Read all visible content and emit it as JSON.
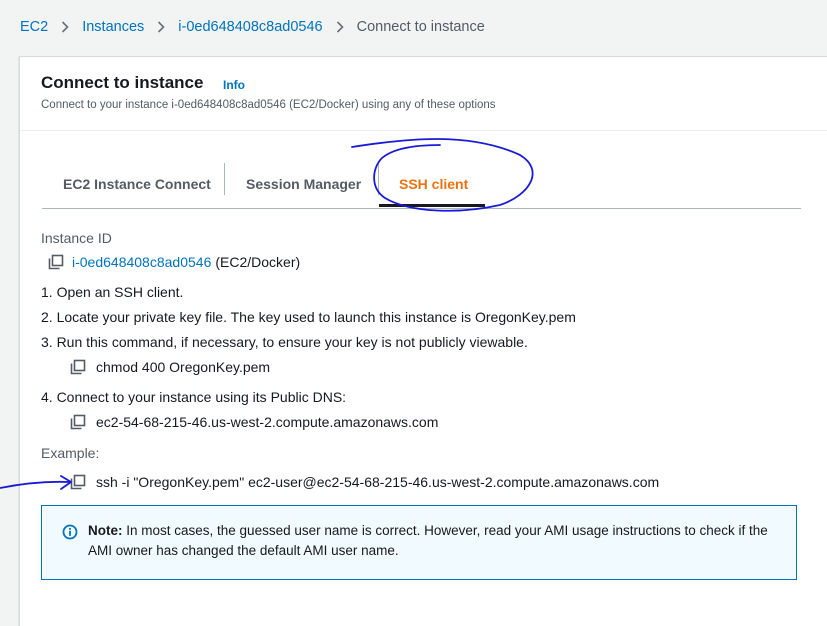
{
  "breadcrumb": {
    "items": [
      "EC2",
      "Instances",
      "i-0ed648408c8ad0546"
    ],
    "current": "Connect to instance"
  },
  "header": {
    "title": "Connect to instance",
    "info_label": "Info",
    "description": "Connect to your instance i-0ed648408c8ad0546 (EC2/Docker) using any of these options"
  },
  "tabs": [
    {
      "label": "EC2 Instance Connect",
      "active": false
    },
    {
      "label": "Session Manager",
      "active": false
    },
    {
      "label": "SSH client",
      "active": true
    }
  ],
  "content": {
    "instance_id_label": "Instance ID",
    "instance_id": "i-0ed648408c8ad0546",
    "instance_name": "(EC2/Docker)",
    "steps": [
      "1. Open an SSH client.",
      "2. Locate your private key file. The key used to launch this instance is OregonKey.pem",
      "3. Run this command, if necessary, to ensure your key is not publicly viewable.",
      "4. Connect to your instance using its Public DNS:"
    ],
    "chmod_command": "chmod 400 OregonKey.pem",
    "public_dns": "ec2-54-68-215-46.us-west-2.compute.amazonaws.com",
    "example_label": "Example:",
    "ssh_command": "ssh -i \"OregonKey.pem\" ec2-user@ec2-54-68-215-46.us-west-2.compute.amazonaws.com"
  },
  "note": {
    "prefix": "Note:",
    "text": " In most cases, the guessed user name is correct. However, read your AMI usage instructions to check if the AMI owner has changed the default AMI user name."
  },
  "colors": {
    "link": "#0073bb",
    "active_tab": "#ec7211",
    "annotation": "#1a1ad6",
    "note_bg": "#f1faff"
  }
}
